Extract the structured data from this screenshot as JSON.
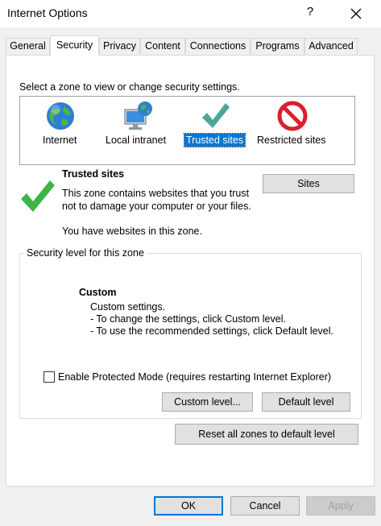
{
  "window": {
    "title": "Internet Options",
    "help_glyph": "?"
  },
  "tabs": [
    {
      "label": "General"
    },
    {
      "label": "Security"
    },
    {
      "label": "Privacy"
    },
    {
      "label": "Content"
    },
    {
      "label": "Connections"
    },
    {
      "label": "Programs"
    },
    {
      "label": "Advanced"
    }
  ],
  "active_tab": "Security",
  "security": {
    "zone_prompt": "Select a zone to view or change security settings.",
    "zones": [
      {
        "label": "Internet",
        "icon": "globe-icon"
      },
      {
        "label": "Local intranet",
        "icon": "intranet-icon"
      },
      {
        "label": "Trusted sites",
        "icon": "checkmark-icon"
      },
      {
        "label": "Restricted sites",
        "icon": "restricted-icon"
      }
    ],
    "selected_zone": "Trusted sites",
    "zone_title": "Trusted sites",
    "zone_description": "This zone contains websites that you trust not to damage your computer or your files.",
    "zone_note": "You have websites in this zone.",
    "sites_button": "Sites",
    "level_group_label": "Security level for this zone",
    "level_name": "Custom",
    "level_lines": [
      "Custom settings.",
      "- To change the settings, click Custom level.",
      "- To use the recommended settings, click Default level."
    ],
    "protected_mode_label": "Enable Protected Mode (requires restarting Internet Explorer)",
    "protected_mode_checked": false,
    "custom_level_button": "Custom level...",
    "default_level_button": "Default level",
    "reset_all_button": "Reset all zones to default level"
  },
  "footer": {
    "ok": "OK",
    "cancel": "Cancel",
    "apply": "Apply"
  },
  "colors": {
    "selection": "#0078d7",
    "check_green": "#3cb44a",
    "restricted_red": "#d9202c"
  }
}
